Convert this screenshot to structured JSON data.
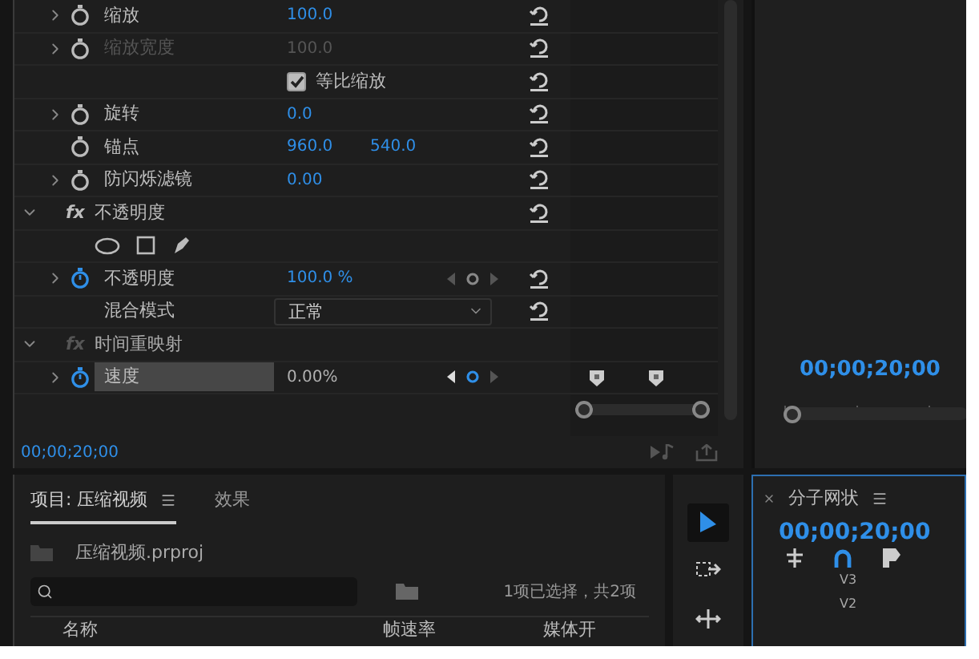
{
  "effect_controls": {
    "rows": [
      {
        "kind": "property",
        "name": "缩放",
        "values": [
          "100.0"
        ],
        "expandable": true,
        "enabled": true,
        "animated": false,
        "selected": false,
        "resettable": true,
        "keyframe_nav": false,
        "keyframe_markers": false
      },
      {
        "kind": "property",
        "name": "缩放宽度",
        "values": [
          "100.0"
        ],
        "expandable": true,
        "enabled": false,
        "animated": false,
        "selected": false,
        "resettable": true,
        "keyframe_nav": false,
        "keyframe_markers": false
      },
      {
        "kind": "checkbox",
        "name": "等比缩放",
        "checked": true,
        "resettable": true
      },
      {
        "kind": "property",
        "name": "旋转",
        "values": [
          "0.0"
        ],
        "expandable": true,
        "enabled": true,
        "animated": false,
        "selected": false,
        "resettable": true,
        "keyframe_nav": false,
        "keyframe_markers": false
      },
      {
        "kind": "property",
        "name": "锚点",
        "values": [
          "960.0",
          "540.0"
        ],
        "expandable": false,
        "enabled": true,
        "animated": false,
        "selected": false,
        "resettable": true,
        "keyframe_nav": false,
        "keyframe_markers": false
      },
      {
        "kind": "property",
        "name": "防闪烁滤镜",
        "values": [
          "0.00"
        ],
        "expandable": true,
        "enabled": true,
        "animated": false,
        "selected": false,
        "resettable": true,
        "keyframe_nav": false,
        "keyframe_markers": false
      },
      {
        "kind": "section",
        "badge": "fx",
        "name": "不透明度",
        "expanded": true,
        "enabled": true,
        "resettable": true
      },
      {
        "kind": "mask_tools",
        "resettable": false
      },
      {
        "kind": "property",
        "name": "不透明度",
        "values": [
          "100.0 %"
        ],
        "expandable": true,
        "enabled": true,
        "animated": true,
        "selected": false,
        "resettable": true,
        "keyframe_nav": true,
        "keyframe_markers": false
      },
      {
        "kind": "dropdown",
        "name": "混合模式",
        "value": "正常",
        "resettable": true
      },
      {
        "kind": "section",
        "badge": "fx",
        "name": "时间重映射",
        "expanded": true,
        "enabled": false,
        "resettable": false
      },
      {
        "kind": "property",
        "name": "速度",
        "values": [
          "0.00%"
        ],
        "expandable": true,
        "enabled": true,
        "animated": true,
        "selected": true,
        "resettable": false,
        "keyframe_nav": true,
        "keyframe_markers": true
      }
    ],
    "current_time": "00;00;20;00"
  },
  "program_monitor": {
    "timecode": "00;00;20;00"
  },
  "project_panel": {
    "tabs": [
      {
        "label": "项目: 压缩视频",
        "selected": true,
        "has_menu": true
      },
      {
        "label": "效果",
        "selected": false,
        "has_menu": false
      }
    ],
    "file": "压缩视频.prproj",
    "status": "1项已选择，共2项",
    "columns": [
      "名称",
      "帧速率",
      "媒体开"
    ]
  },
  "tools": [
    {
      "kind": "selection",
      "selected": true
    },
    {
      "kind": "track_select",
      "selected": false
    },
    {
      "kind": "ripple",
      "selected": false
    }
  ],
  "timeline": {
    "title": "分子网状",
    "timecode": "00;00;20;00",
    "tracks": [
      "V3",
      "V2"
    ]
  }
}
